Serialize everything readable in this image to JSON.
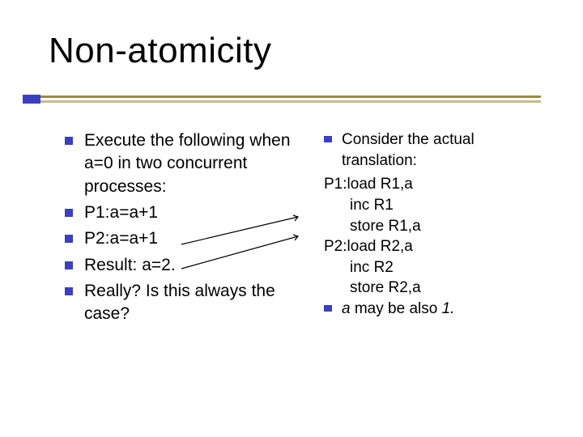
{
  "title": "Non-atomicity",
  "left": {
    "items": [
      "Execute the following when a=0 in two concurrent processes:",
      "P1:a=a+1",
      "P2:a=a+1",
      "Result: a=2.",
      "Really? Is this always the case?"
    ]
  },
  "right": {
    "lead": "Consider the actual translation:",
    "p1_label": "P1:",
    "p1_lines": [
      "load R1,a",
      "inc R1",
      "store R1,a"
    ],
    "p2_label": "P2:",
    "p2_lines": [
      "load R2,a",
      "inc R2",
      "store R2,a"
    ],
    "tail_pre": "a",
    "tail_mid": " may be also ",
    "tail_post": "1."
  },
  "colors": {
    "bullet": "#3b3fc2",
    "rule_top": "#9a8a4a",
    "rule_bottom": "#c7bb8e"
  }
}
